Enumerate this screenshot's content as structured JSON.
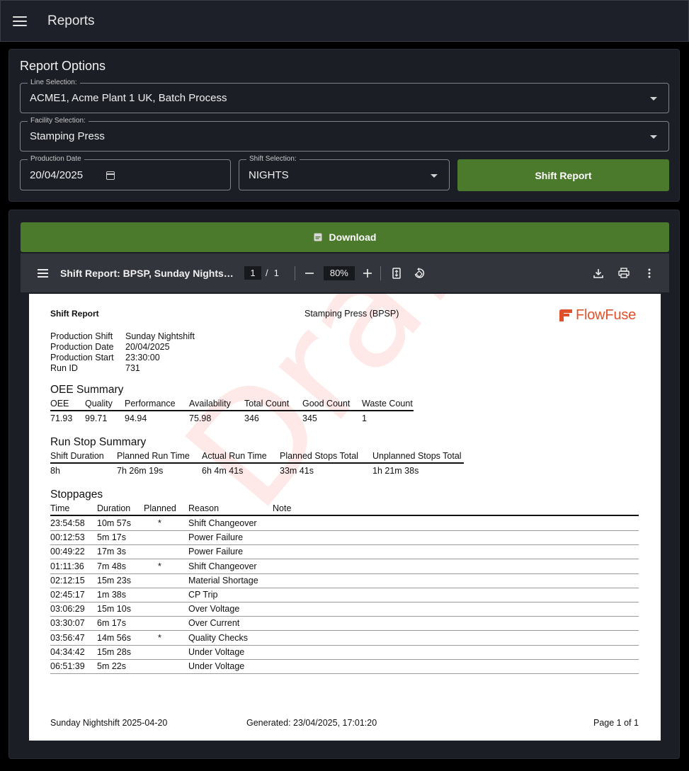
{
  "app": {
    "title": "Reports"
  },
  "options": {
    "title": "Report Options",
    "line": {
      "label": "Line Selection:",
      "value": "ACME1, Acme Plant 1 UK, Batch Process"
    },
    "facility": {
      "label": "Facility Selection:",
      "value": "Stamping Press"
    },
    "date": {
      "label": "Production Date",
      "value": "20/04/2025"
    },
    "shift": {
      "label": "Shift Selection:",
      "value": "NIGHTS"
    },
    "shift_report_button": "Shift Report"
  },
  "download": {
    "label": "Download",
    "icon": "pdf-file-icon"
  },
  "viewer": {
    "doc_title": "Shift Report: BPSP, Sunday Nightshi...",
    "page_current": "1",
    "page_sep": "/",
    "page_total": "1",
    "zoom": "80%"
  },
  "report": {
    "header_left": "Shift Report",
    "header_center": "Stamping Press (BPSP)",
    "logo_text": "FlowFuse",
    "watermark": "Draft",
    "info": [
      {
        "label": "Production Shift",
        "value": "Sunday Nightshift"
      },
      {
        "label": "Production Date",
        "value": "20/04/2025"
      },
      {
        "label": "Production Start",
        "value": "23:30:00"
      },
      {
        "label": "Run ID",
        "value": "731"
      }
    ],
    "oee": {
      "title": "OEE Summary",
      "headers": [
        "OEE",
        "Quality",
        "Performance",
        "Availability",
        "Total Count",
        "Good Count",
        "Waste Count"
      ],
      "values": [
        "71.93",
        "99.71",
        "94.94",
        "75.98",
        "346",
        "345",
        "1"
      ]
    },
    "runstop": {
      "title": "Run Stop Summary",
      "headers": [
        "Shift Duration",
        "Planned Run Time",
        "Actual Run Time",
        "Planned Stops Total",
        "Unplanned Stops Total"
      ],
      "values": [
        "8h",
        "7h 26m 19s",
        "6h 4m 41s",
        "33m 41s",
        "1h 21m 38s"
      ]
    },
    "stoppages": {
      "title": "Stoppages",
      "headers": [
        "Time",
        "Duration",
        "Planned",
        "Reason",
        "Note"
      ],
      "rows": [
        [
          "23:54:58",
          "10m 57s",
          "*",
          "Shift Changeover",
          ""
        ],
        [
          "00:12:53",
          "5m 17s",
          "",
          "Power Failure",
          ""
        ],
        [
          "00:49:22",
          "17m 3s",
          "",
          "Power Failure",
          ""
        ],
        [
          "01:11:36",
          "7m 48s",
          "*",
          "Shift Changeover",
          ""
        ],
        [
          "02:12:15",
          "15m 23s",
          "",
          "Material Shortage",
          ""
        ],
        [
          "02:45:17",
          "1m 38s",
          "",
          "CP Trip",
          ""
        ],
        [
          "03:06:29",
          "15m 10s",
          "",
          "Over Voltage",
          ""
        ],
        [
          "03:30:07",
          "6m 17s",
          "",
          "Over Current",
          ""
        ],
        [
          "03:56:47",
          "14m 56s",
          "*",
          "Quality Checks",
          ""
        ],
        [
          "04:34:42",
          "15m 28s",
          "",
          "Under Voltage",
          ""
        ],
        [
          "06:51:39",
          "5m 22s",
          "",
          "Under Voltage",
          ""
        ]
      ]
    },
    "footer": {
      "left": "Sunday Nightshift 2025-04-20",
      "center": "Generated: 23/04/2025, 17:01:20",
      "right": "Page 1 of 1"
    }
  },
  "colors": {
    "accent_green": "#4c7a2d",
    "brand_orange": "#e0502a",
    "background": "#1c1e26"
  }
}
